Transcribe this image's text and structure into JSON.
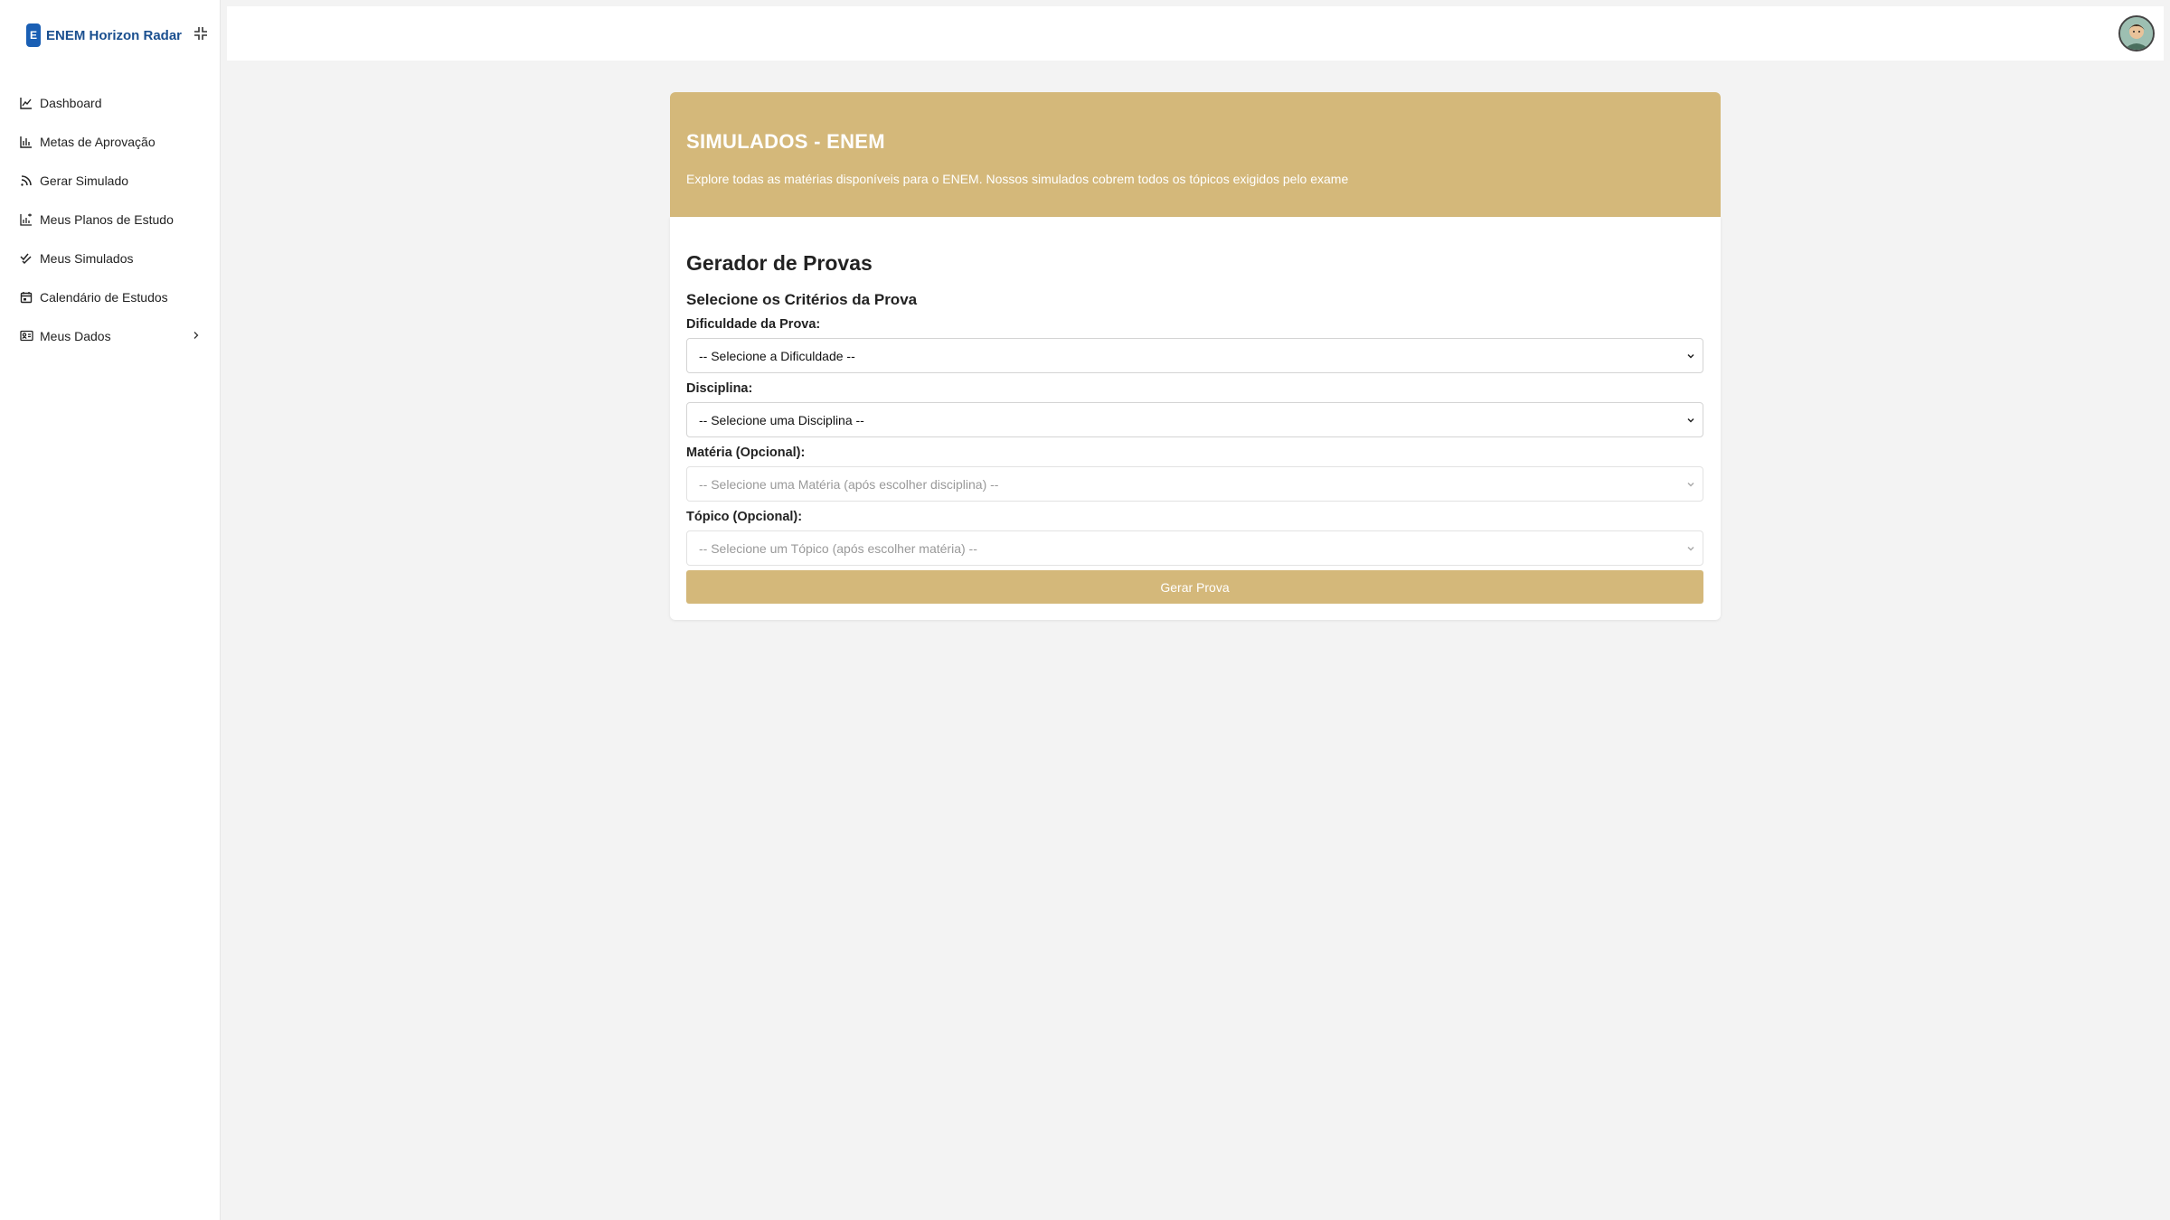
{
  "sidebar": {
    "brand": {
      "badge": "E",
      "name": "ENEM Horizon Radar"
    },
    "items": [
      {
        "label": "Dashboard",
        "icon": "line-chart-icon"
      },
      {
        "label": "Metas de Aprovação",
        "icon": "bar-chart-icon"
      },
      {
        "label": "Gerar Simulado",
        "icon": "rss-icon"
      },
      {
        "label": "Meus Planos de Estudo",
        "icon": "study-plan-icon"
      },
      {
        "label": "Meus Simulados",
        "icon": "double-check-icon"
      },
      {
        "label": "Calendário de Estudos",
        "icon": "calendar-icon"
      },
      {
        "label": "Meus Dados",
        "icon": "id-card-icon"
      }
    ]
  },
  "banner": {
    "title": "SIMULADOS - ENEM",
    "description": "Explore todas as matérias disponíveis para o ENEM. Nossos simulados cobrem todos os tópicos exigidos pelo exame"
  },
  "form": {
    "title": "Gerador de Provas",
    "subtitle": "Selecione os Critérios da Prova",
    "difficulty": {
      "label": "Dificuldade da Prova:",
      "value": "-- Selecione a Dificuldade --"
    },
    "discipline": {
      "label": "Disciplina:",
      "value": "-- Selecione uma Disciplina --"
    },
    "subject": {
      "label": "Matéria (Opcional):",
      "value": "-- Selecione uma Matéria (após escolher disciplina) --"
    },
    "topic": {
      "label": "Tópico (Opcional):",
      "value": "-- Selecione um Tópico (após escolher matéria) --"
    },
    "submit_label": "Gerar Prova"
  },
  "colors": {
    "accent": "#d4b87a",
    "brand": "#1a5fb4",
    "background": "#f3f3f3"
  }
}
